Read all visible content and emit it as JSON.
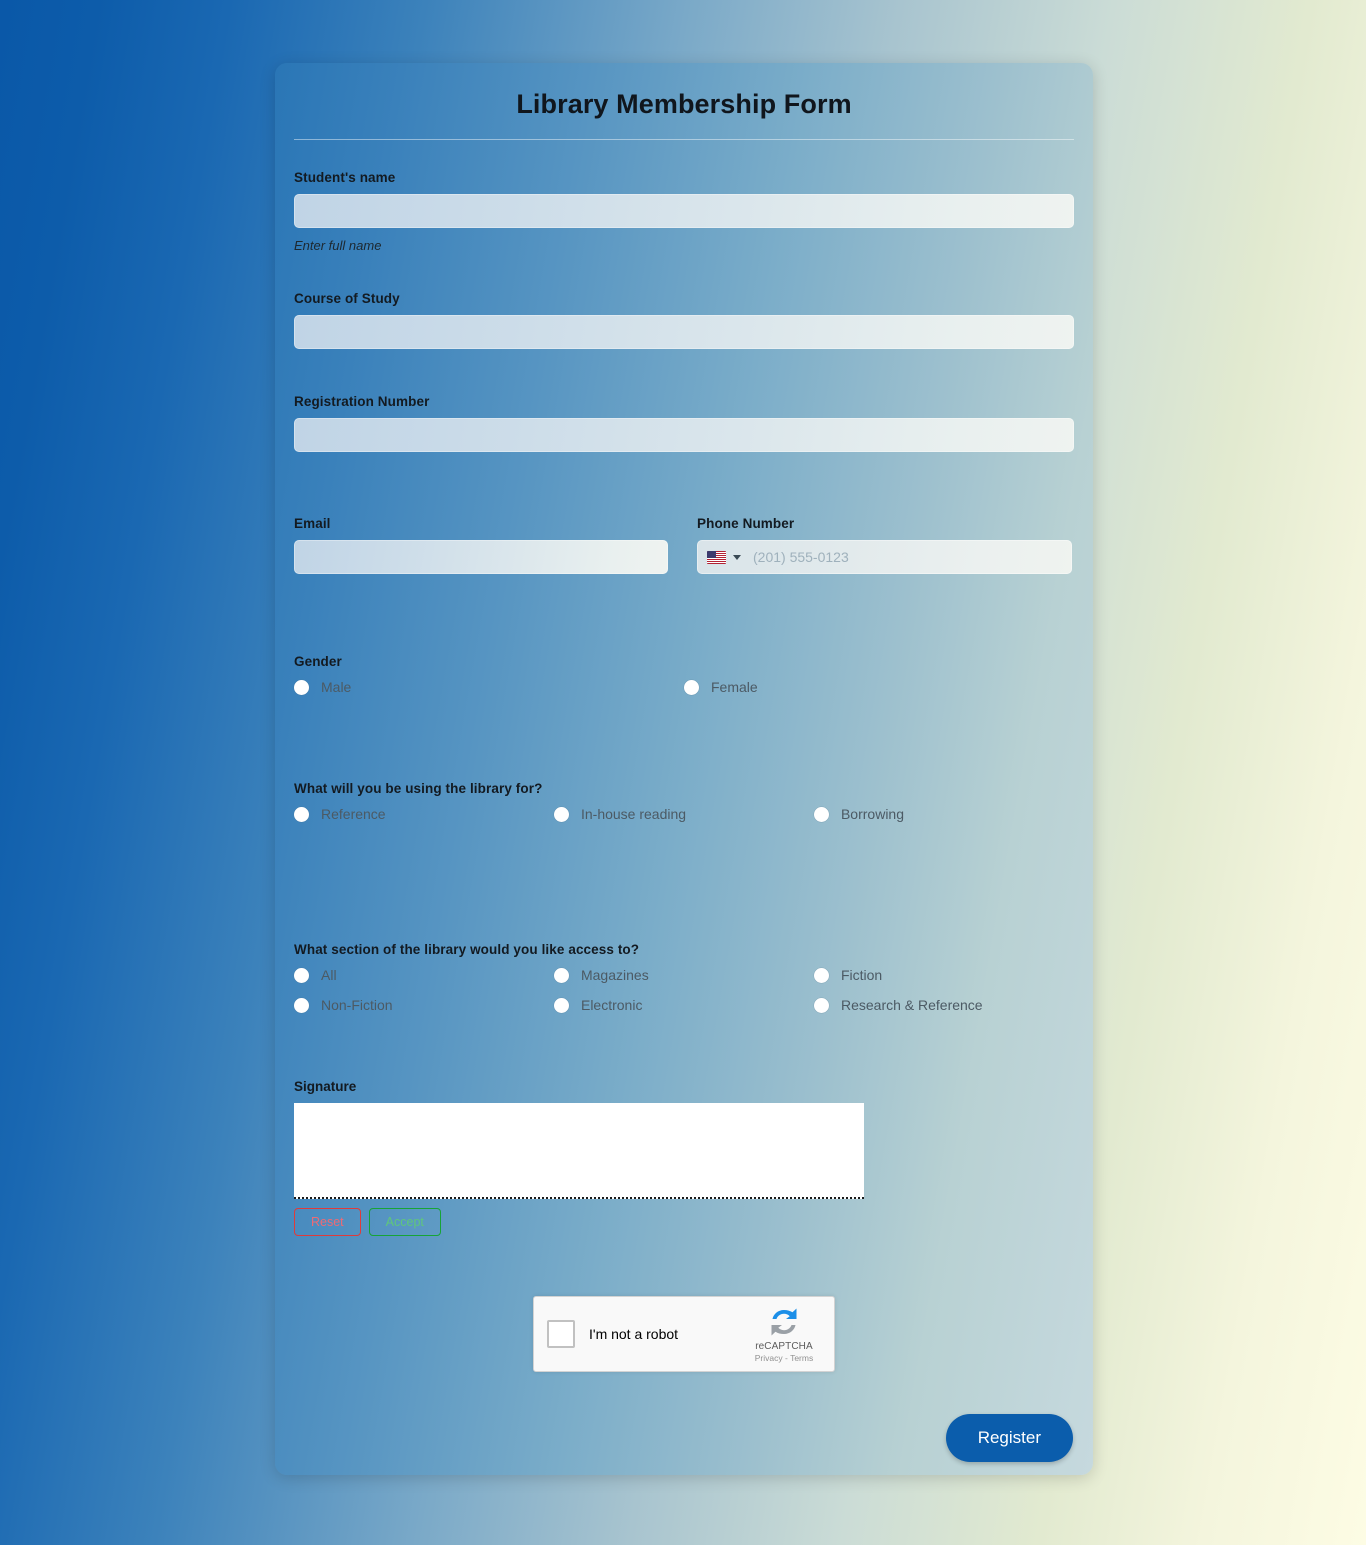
{
  "form": {
    "title": "Library Membership Form",
    "student_name": {
      "label": "Student's name",
      "value": "",
      "placeholder": "",
      "helper": "Enter full name"
    },
    "course_of_study": {
      "label": "Course of Study",
      "value": "",
      "placeholder": ""
    },
    "registration_number": {
      "label": "Registration Number",
      "value": "",
      "placeholder": ""
    },
    "email": {
      "label": "Email",
      "value": "",
      "placeholder": ""
    },
    "phone": {
      "label": "Phone Number",
      "country_flag": "us-flag-icon",
      "placeholder": "(201) 555-0123",
      "value": ""
    },
    "gender": {
      "label": "Gender",
      "options": [
        {
          "label": "Male",
          "selected": false
        },
        {
          "label": "Female",
          "selected": false
        }
      ]
    },
    "usage": {
      "label": "What will you be using the library for?",
      "options": [
        {
          "label": "Reference",
          "selected": false
        },
        {
          "label": "In-house reading",
          "selected": false
        },
        {
          "label": "Borrowing",
          "selected": false
        }
      ]
    },
    "section_access": {
      "label": "What section of the library would you like access to?",
      "options": [
        {
          "label": "All",
          "selected": false
        },
        {
          "label": "Magazines",
          "selected": false
        },
        {
          "label": "Fiction",
          "selected": false
        },
        {
          "label": "Non-Fiction",
          "selected": false
        },
        {
          "label": "Electronic",
          "selected": false
        },
        {
          "label": "Research & Reference",
          "selected": false
        }
      ]
    },
    "signature": {
      "label": "Signature",
      "reset_label": "Reset",
      "accept_label": "Accept"
    },
    "recaptcha": {
      "checkbox_label": "I'm not a robot",
      "brand": "reCAPTCHA",
      "privacy_label": "Privacy",
      "separator": "-",
      "terms_label": "Terms",
      "checked": false
    },
    "submit": {
      "label": "Register"
    }
  },
  "colors": {
    "accent": "#0b5dac",
    "page_gradient_start": "#0a58a8",
    "page_gradient_end": "#fdfce4",
    "reset_outline": "#e03a3a",
    "accept_outline": "#17a436",
    "title_text": "#10161d"
  }
}
